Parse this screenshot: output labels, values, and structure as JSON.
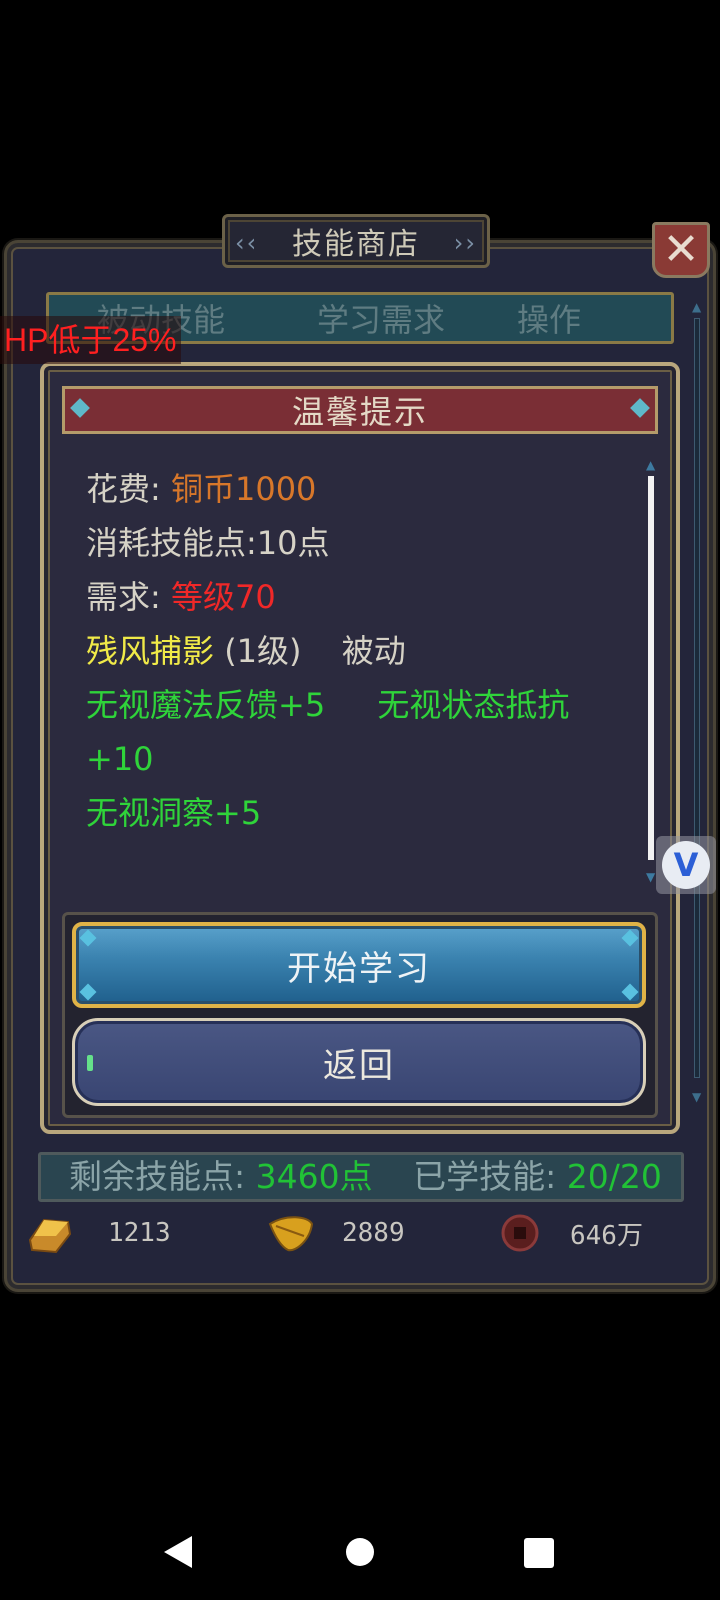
{
  "shop": {
    "title": "技能商店",
    "close": "✕",
    "header": {
      "col1": "被动技能",
      "col2": "学习需求",
      "col3": "操作"
    }
  },
  "hp_warning": "HP低于25%",
  "dialog": {
    "title": "温馨提示",
    "cost_label": "花费:",
    "cost_value": "铜币1000",
    "consume": "消耗技能点:10点",
    "req_label": "需求:",
    "req_value": "等级70",
    "skill_name": "残风捕影",
    "skill_level": "(1级)",
    "skill_type": "被动",
    "effect1": "无视魔法反馈+5",
    "effect2": "无视状态抵抗",
    "effect2_cont": "+10",
    "effect3": "无视洞察+5",
    "start_button": "开始学习",
    "back_button": "返回"
  },
  "status": {
    "remaining_label": "剩余技能点:",
    "remaining_value": "3460点",
    "learned_label": "已学技能:",
    "learned_value": "20/20"
  },
  "currency": [
    {
      "icon": "gold-bar-icon",
      "value": "1213"
    },
    {
      "icon": "leaf-icon",
      "value": "2889"
    },
    {
      "icon": "coin-icon",
      "value": "646万"
    }
  ],
  "floating": {
    "label": "V"
  },
  "colors": {
    "cost": "#d8772a",
    "requirement": "#f02828",
    "skill": "#f0ea48",
    "effect": "#2fd43a",
    "button_gold": "#e0b347"
  }
}
